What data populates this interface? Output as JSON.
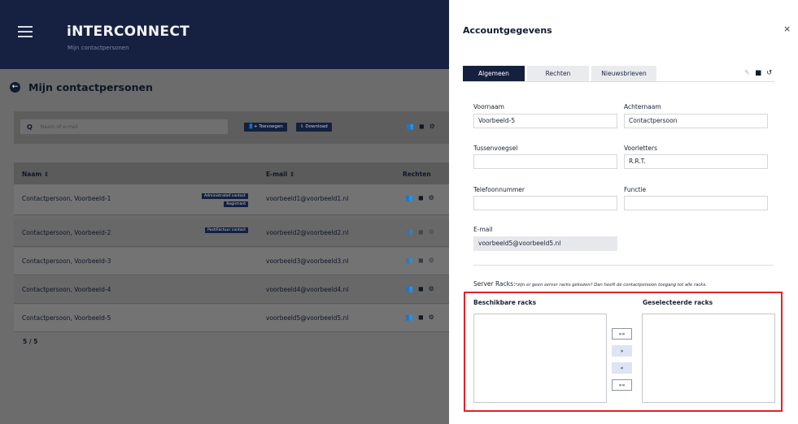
{
  "app": {
    "brand": "iNTERCONNECT",
    "brand_sub": "Mijn contactpersonen",
    "page_title": "Mijn contactpersonen",
    "search_placeholder": "Naam of e-mail",
    "add_button": "Toevoegen",
    "download_button": "Download",
    "table_headers": {
      "name": "Naam ⇕",
      "email": "E-mail ⇕",
      "rights": "Rechten"
    },
    "rows": [
      {
        "name": "Contactpersoon, Voorbeeld-1",
        "email": "voorbeeld1@voorbeeld1.nl",
        "badges": [
          "Administratief contact",
          "Registrant"
        ]
      },
      {
        "name": "Contactpersoon, Voorbeeld-2",
        "email": "voorbeeld2@voorbeeld2.nl",
        "badges": [
          "Post/Factuur contact"
        ]
      },
      {
        "name": "Contactpersoon, Voorbeeld-3",
        "email": "voorbeeld3@voorbeeld3.nl",
        "badges": []
      },
      {
        "name": "Contactpersoon, Voorbeeld-4",
        "email": "voorbeeld4@voorbeeld4.nl",
        "badges": []
      },
      {
        "name": "Contactpersoon, Voorbeeld-5",
        "email": "voorbeeld5@voorbeeld5.nl",
        "badges": []
      }
    ],
    "pager": "5 / 5"
  },
  "panel": {
    "title": "Accountgegevens",
    "close": "×",
    "tabs": [
      "Algemeen",
      "Rechten",
      "Nieuwsbrieven"
    ],
    "fields": {
      "voornaam_label": "Voornaam",
      "voornaam_value": "Voorbeeld-5",
      "achternaam_label": "Achternaam",
      "achternaam_value": "Contactpersoon",
      "tussenvoegsel_label": "Tussenvoegsel",
      "tussenvoegsel_value": "",
      "voorletters_label": "Voorletters",
      "voorletters_value": "R.R.T.",
      "telefoon_label": "Telefoonnummer",
      "telefoon_value": "",
      "functie_label": "Functie",
      "functie_value": "",
      "email_label": "E-mail",
      "email_value": "voorbeeld5@voorbeeld5.nl"
    },
    "racks": {
      "label": "Server Racks:",
      "note": "*zijn er geen server racks gekozen? Dan heeft de contactpersoon toegang tot alle racks.",
      "available_title": "Beschikbare racks",
      "selected_title": "Geselecteerde racks",
      "move_all_right": "»»",
      "move_right": "»",
      "move_left": "«",
      "move_all_left": "««"
    },
    "accent_color": "#14203d",
    "highlight_color": "#e0232b"
  }
}
